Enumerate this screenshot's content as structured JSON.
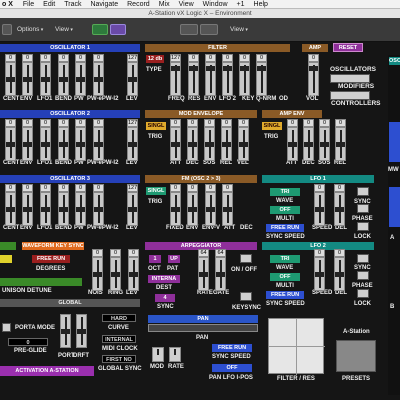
{
  "menubar": {
    "app": "o X",
    "items": [
      "File",
      "Edit",
      "Track",
      "Navigate",
      "Record",
      "Mix",
      "View",
      "Window",
      "+1",
      "Help"
    ]
  },
  "window": {
    "title": "A-Station vX Logic X – Environment"
  },
  "toolbar": {
    "options": "Options",
    "view": "View",
    "view2": "View"
  },
  "sections": {
    "osc1": "OSCILLATOR 1",
    "filter": "FILTER",
    "amp": "AMP",
    "reset": "RESET",
    "osc2": "OSCILLATOR 2",
    "mod_env": "MOD ENVELOPE",
    "amp_env": "AMP ENV",
    "osc3": "OSCILLATOR 3",
    "fm": "FM (OSC 2 > 3)",
    "lfo1": "LFO 1",
    "wks": "WAVEFORM KEY SYNC",
    "arp": "ARPEGGIATOR",
    "lfo2": "LFO 2",
    "global": "GLOBAL",
    "pan": "PAN",
    "oscillators": "OSCILLATORS",
    "modifiers": "MODIFIERS",
    "controllers": "CONTROLLERS"
  },
  "osc1": {
    "labels": [
      "CENT",
      "ENV",
      "LFO1",
      "BEND",
      "PW",
      "PW-ePW-I2",
      "LEV"
    ],
    "values": [
      "0",
      "0",
      "0",
      "0",
      "0",
      "0",
      "127"
    ]
  },
  "filter": {
    "type_value": "12 db",
    "type_label": "TYPE",
    "values": [
      "127",
      "0",
      "0",
      "0",
      "0",
      "0"
    ],
    "labels": [
      "FREQ",
      "RES",
      "ENV",
      "LFO 2",
      "KEY",
      "Q-NRM",
      "OD"
    ]
  },
  "amp": {
    "value": "0",
    "label": "VOL"
  },
  "osc2": {
    "labels": [
      "CENT",
      "ENV",
      "LFO1",
      "BEND",
      "PW",
      "PW-ePW-I2",
      "LEV"
    ],
    "values": [
      "0",
      "0",
      "0",
      "0",
      "0",
      "0",
      "127"
    ]
  },
  "mod_env": {
    "singl": "SINGL",
    "trig": "TRIG",
    "values": [
      "0",
      "0",
      "0",
      "0",
      "0"
    ],
    "labels": [
      "ATT",
      "DEC",
      "SUS",
      "REL",
      "VEL"
    ]
  },
  "amp_env": {
    "singl": "SINGL",
    "trig": "TRIG",
    "values": [
      "0",
      "0",
      "0",
      "0"
    ],
    "labels": [
      "ATT",
      "DEC",
      "SUS",
      "REL"
    ]
  },
  "osc3": {
    "labels": [
      "CENT",
      "ENV",
      "LFO1",
      "BEND",
      "PW",
      "PW-ePW-I2",
      "LEV"
    ],
    "values": [
      "0",
      "0",
      "0",
      "0",
      "0",
      "0",
      "127"
    ]
  },
  "fm": {
    "singl": "SINGL",
    "trig": "TRIG",
    "values": [
      "0",
      "0",
      "0",
      "0"
    ],
    "labels": [
      "FIXED",
      "ENV",
      "ENV-V",
      "ATT",
      "DEC"
    ]
  },
  "lfo1": {
    "wave_value": "TRI",
    "wave_label": "WAVE",
    "multi_value": "OFF",
    "multi_label": "MULTI",
    "sync_value": "FREE RUN",
    "sync_label": "SYNC SPEED",
    "speed_label": "SPEED",
    "del_label": "DEL",
    "sync": "SYNC",
    "phase": "PHASE",
    "lock": "LOCK",
    "values": [
      "0",
      "0"
    ]
  },
  "wks": {
    "free_run": "FREE RUN",
    "degrees": "DEGREES",
    "unison": "UNISON DETUNE",
    "lev_values": [
      "0",
      "0",
      "0"
    ],
    "lev_labels": [
      "NOIS",
      "RING",
      "LEV"
    ]
  },
  "arp": {
    "oct_value": "1",
    "oct_label": "OCT",
    "pat_value": "UP",
    "pat_label": "PAT",
    "mode_value": "INTERNA",
    "dest_label": "DEST",
    "sync_value": "4",
    "sync_label": "SYNC",
    "on_off": "ON / OFF",
    "rate_label": "RATE",
    "gate_label": "GATE",
    "keysync": "KEYSYNC",
    "values": [
      "64",
      "64"
    ]
  },
  "lfo2": {
    "wave_value": "TRI",
    "wave_label": "WAVE",
    "multi_value": "OFF",
    "multi_label": "MULTI",
    "sync_value": "FREE RUN",
    "sync_label": "SYNC SPEED",
    "speed_label": "SPEED",
    "del_label": "DEL",
    "sync": "SYNC",
    "phase": "PHASE",
    "lock": "LOCK",
    "values": [
      "0",
      "0"
    ]
  },
  "global": {
    "porta_mode": "PORTA MODE",
    "pre_glide_value": "0",
    "pre_glide": "PRE-GLIDE",
    "port_labels": [
      "PORT",
      "DRFT"
    ],
    "hard": "HARD",
    "curve": "CURVE",
    "internal": "INTERNAL",
    "midi_clock": "MIDI CLOCK",
    "first_no": "FIRST NO",
    "global_sync": "GLOBAL SYNC",
    "mod": "MOD",
    "rate": "RATE",
    "activation": "ACTIVATION A-STATION"
  },
  "pan": {
    "label": "PAN",
    "sync_speed_value": "FREE RUN",
    "sync_speed": "SYNC SPEED",
    "lfo_value": "OFF",
    "lfo": "PAN LFO I-POS"
  },
  "bottom": {
    "filter_res": "FILTER / RES",
    "a_station": "A-Station",
    "presets": "PRESETS"
  },
  "side": {
    "osc": "OSC",
    "mw": "MW",
    "a": "A",
    "b": "B"
  }
}
